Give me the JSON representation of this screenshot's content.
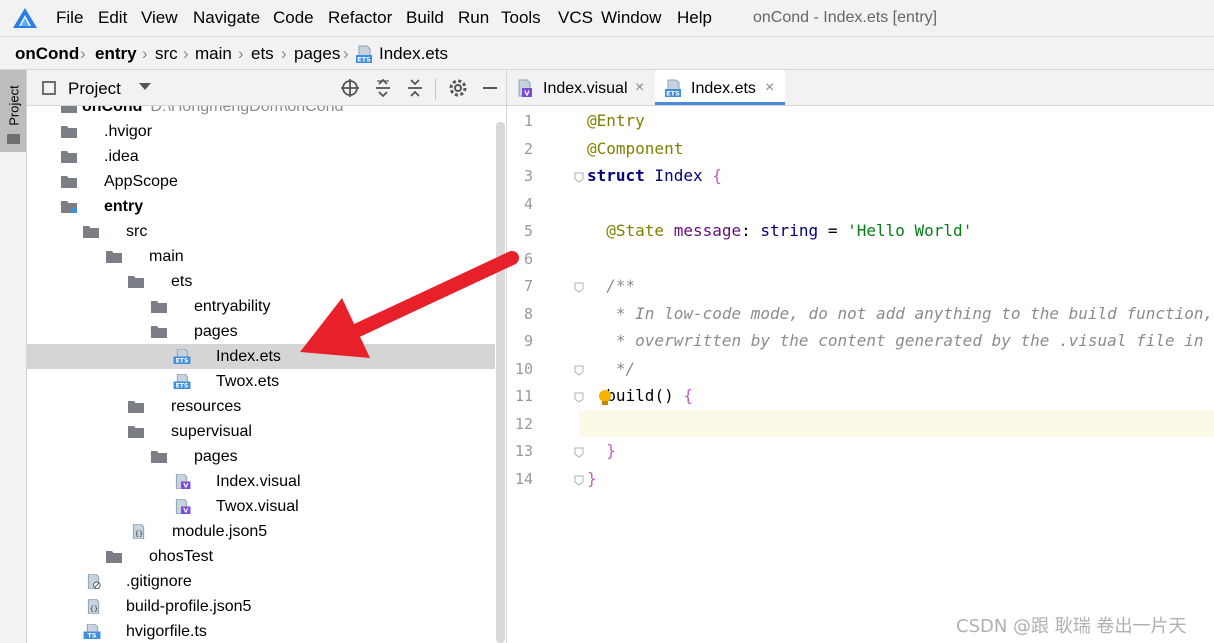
{
  "menubar": {
    "items": [
      "File",
      "Edit",
      "View",
      "Navigate",
      "Code",
      "Refactor",
      "Build",
      "Run",
      "Tools",
      "VCS",
      "Window",
      "Help"
    ],
    "window_title": "onCond - Index.ets [entry]"
  },
  "breadcrumb": [
    "onCond",
    "entry",
    "src",
    "main",
    "ets",
    "pages",
    "Index.ets"
  ],
  "project_panel": {
    "title": "Project",
    "side_tab": "Project",
    "tree": [
      {
        "label": "onCond",
        "path": "D:\\HongmengDom\\onCond",
        "type": "folder",
        "bold": true
      },
      {
        "label": ".hvigor",
        "type": "folder",
        "expanded": false
      },
      {
        "label": ".idea",
        "type": "folder",
        "expanded": false
      },
      {
        "label": "AppScope",
        "type": "folder",
        "expanded": false
      },
      {
        "label": "entry",
        "type": "module-folder",
        "expanded": true,
        "bold": true
      },
      {
        "label": "src",
        "type": "folder",
        "expanded": true
      },
      {
        "label": "main",
        "type": "folder",
        "expanded": true
      },
      {
        "label": "ets",
        "type": "folder",
        "expanded": true
      },
      {
        "label": "entryability",
        "type": "folder",
        "expanded": false
      },
      {
        "label": "pages",
        "type": "folder",
        "expanded": true
      },
      {
        "label": "Index.ets",
        "type": "ets-file",
        "selected": true
      },
      {
        "label": "Twox.ets",
        "type": "ets-file"
      },
      {
        "label": "resources",
        "type": "folder",
        "expanded": false
      },
      {
        "label": "supervisual",
        "type": "folder",
        "expanded": true
      },
      {
        "label": "pages",
        "type": "folder",
        "expanded": true
      },
      {
        "label": "Index.visual",
        "type": "visual-file"
      },
      {
        "label": "Twox.visual",
        "type": "visual-file"
      },
      {
        "label": "module.json5",
        "type": "json-file"
      },
      {
        "label": "ohosTest",
        "type": "folder",
        "expanded": false
      },
      {
        "label": ".gitignore",
        "type": "ignore-file"
      },
      {
        "label": "build-profile.json5",
        "type": "json-file"
      },
      {
        "label": "hvigorfile.ts",
        "type": "ts-file"
      }
    ]
  },
  "editor": {
    "tabs": [
      {
        "label": "Index.visual",
        "icon": "visual-file-icon",
        "active": false
      },
      {
        "label": "Index.ets",
        "icon": "ets-file-icon",
        "active": true
      }
    ],
    "line_numbers": [
      "1",
      "2",
      "3",
      "4",
      "5",
      "6",
      "7",
      "8",
      "9",
      "10",
      "11",
      "12",
      "13",
      "14"
    ],
    "current_line": 12,
    "code_lines": [
      [
        {
          "t": "@Entry",
          "c": "anno"
        }
      ],
      [
        {
          "t": "@Component",
          "c": "anno"
        }
      ],
      [
        {
          "t": "struct",
          "c": "kw"
        },
        {
          "t": " Index ",
          "c": "type"
        },
        {
          "t": "{",
          "c": "brace"
        }
      ],
      [],
      [
        {
          "t": "  @State",
          "c": "anno"
        },
        {
          "t": " message",
          "c": "prop"
        },
        {
          "t": ": ",
          "c": "plain"
        },
        {
          "t": "string",
          "c": "type"
        },
        {
          "t": " = ",
          "c": "plain"
        },
        {
          "t": "'Hello World'",
          "c": "str"
        }
      ],
      [],
      [
        {
          "t": "  /**",
          "c": "com"
        }
      ],
      [
        {
          "t": "   * In low-code mode, do not add anything to the build function, it will be",
          "c": "com"
        }
      ],
      [
        {
          "t": "   * overwritten by the content generated by the .visual file in the build phase.",
          "c": "com"
        }
      ],
      [
        {
          "t": "   */",
          "c": "com"
        }
      ],
      [
        {
          "t": "  build",
          "c": "plain"
        },
        {
          "t": "() ",
          "c": "plain"
        },
        {
          "t": "{",
          "c": "brace"
        }
      ],
      [],
      [
        {
          "t": "  }",
          "c": "brace"
        }
      ],
      [
        {
          "t": "}",
          "c": "brace"
        }
      ]
    ]
  },
  "watermark": "CSDN @跟 耿瑞 卷出一片天",
  "colors": {
    "accent": "#4a88d8",
    "arrow": "#e8202a",
    "selection": "#d5d5d5"
  }
}
